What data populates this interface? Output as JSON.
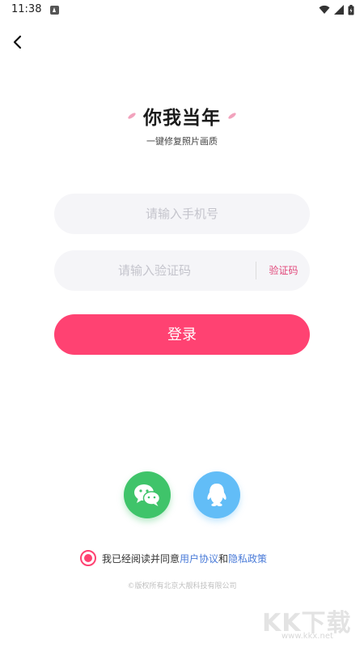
{
  "status_bar": {
    "time": "11:38"
  },
  "header": {
    "back_icon": "chevron-left-icon"
  },
  "brand": {
    "title": "你我当年",
    "subtitle": "一键修复照片画质"
  },
  "form": {
    "phone_placeholder": "请输入手机号",
    "code_placeholder": "请输入验证码",
    "code_button_label": "验证码",
    "login_button_label": "登录"
  },
  "social": {
    "wechat_icon": "wechat-icon",
    "qq_icon": "qq-icon"
  },
  "agreement": {
    "checked": true,
    "prefix": "我已经阅读并同意",
    "user_agreement": "用户协议",
    "and": "和",
    "privacy_policy": "隐私政策"
  },
  "footer": {
    "copyright": "©版权所有北京大靓科技有限公司"
  },
  "watermark": {
    "text": "KK下载",
    "url": "www.kkx.net"
  },
  "colors": {
    "accent": "#ff4272",
    "wechat": "#3fc46a",
    "qq": "#62bdf7",
    "link": "#4a7bd8"
  }
}
